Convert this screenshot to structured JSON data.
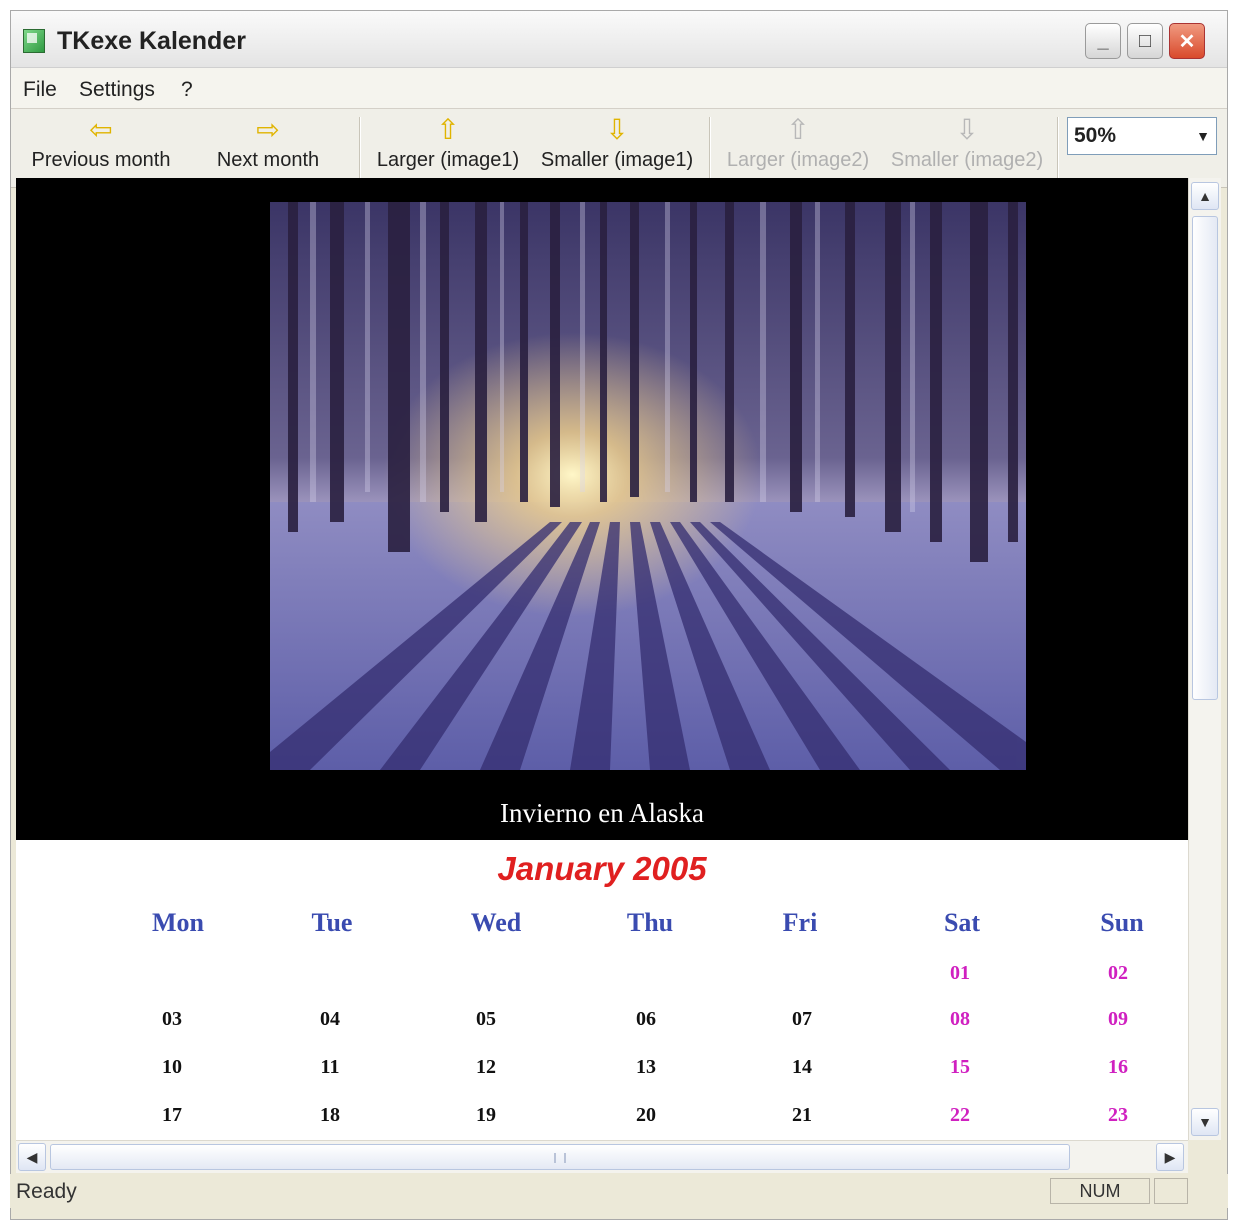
{
  "window": {
    "title": "TKexe Kalender"
  },
  "menu": {
    "items": [
      "File",
      "Settings",
      "?"
    ]
  },
  "toolbar": {
    "buttons": [
      {
        "label": "Previous month",
        "icon": "arrow-left-icon",
        "enabled": true
      },
      {
        "label": "Next month",
        "icon": "arrow-right-icon",
        "enabled": true
      },
      {
        "label": "Larger (image1)",
        "icon": "arrow-up-icon",
        "enabled": true
      },
      {
        "label": "Smaller (image1)",
        "icon": "arrow-down-icon",
        "enabled": true
      },
      {
        "label": "Larger (image2)",
        "icon": "arrow-up-icon",
        "enabled": false
      },
      {
        "label": "Smaller (image2)",
        "icon": "arrow-down-icon",
        "enabled": false
      }
    ],
    "zoom": "50%"
  },
  "photo": {
    "caption": "Invierno en Alaska"
  },
  "calendar": {
    "month_title": "January 2005",
    "day_headers": [
      "Mon",
      "Tue",
      "Wed",
      "Thu",
      "Fri",
      "Sat",
      "Sun"
    ],
    "weeks": [
      [
        "",
        "",
        "",
        "",
        "",
        "01",
        "02"
      ],
      [
        "03",
        "04",
        "05",
        "06",
        "07",
        "08",
        "09"
      ],
      [
        "10",
        "11",
        "12",
        "13",
        "14",
        "15",
        "16"
      ],
      [
        "17",
        "18",
        "19",
        "20",
        "21",
        "22",
        "23"
      ]
    ],
    "colors": {
      "title": "#e02020",
      "header": "#3a4bb0",
      "weekday": "#111111",
      "weekend": "#d020c0"
    }
  },
  "status": {
    "text": "Ready",
    "num": "NUM"
  }
}
